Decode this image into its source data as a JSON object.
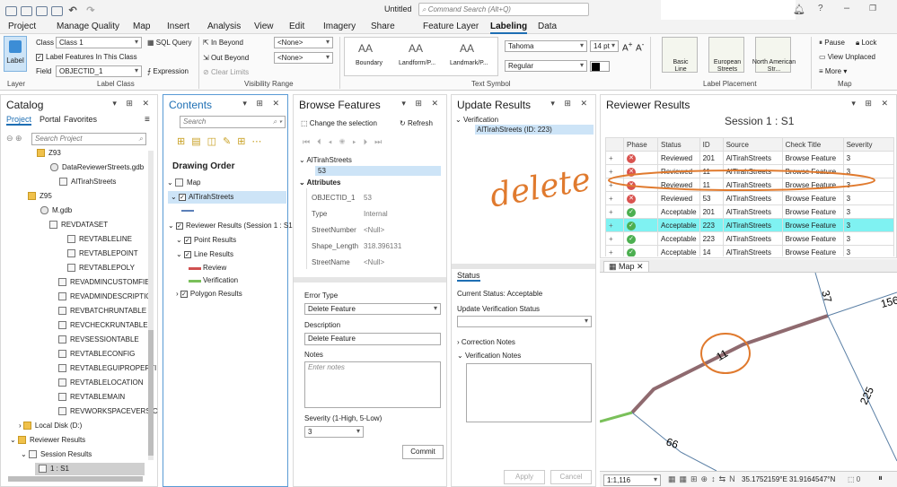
{
  "app": {
    "title": "Untitled",
    "command_search": "Command Search (Alt+Q)"
  },
  "tabs": [
    "Project",
    "Manage Quality",
    "Map",
    "Insert",
    "Analysis",
    "View",
    "Edit",
    "Imagery",
    "Share",
    "Feature Layer",
    "Labeling",
    "Data"
  ],
  "ribbon": {
    "label_button": "Label",
    "class_label": "Class",
    "class_value": "Class 1",
    "sql_query": "SQL Query",
    "label_features": "Label Features In This Class",
    "field_label": "Field",
    "field_value": "OBJECTID_1",
    "expression": "Expression",
    "label_class_group": "Label Class",
    "in_beyond": "In Beyond",
    "out_beyond": "Out Beyond",
    "clear_limits": "Clear Limits",
    "none1": "<None>",
    "none2": "<None>",
    "visibility_group": "Visibility Range",
    "gallery": [
      "Boundary",
      "Landform/P...",
      "Landmark/P..."
    ],
    "font": "Tahoma",
    "size": "14 pt",
    "style": "Regular",
    "text_symbol_group": "Text Symbol",
    "placement": [
      "Basic Line",
      "European Streets",
      "North American Str..."
    ],
    "placement_group": "Label Placement",
    "pause": "Pause",
    "lock": "Lock",
    "view_unplaced": "View Unplaced",
    "more": "More",
    "map_group": "Map",
    "layer_group": "Layer"
  },
  "catalog": {
    "title": "Catalog",
    "tabs": [
      "Project",
      "Portal",
      "Favorites"
    ],
    "search": "Search Project",
    "items": [
      "Z93",
      "DataReviewerStreets.gdb",
      "AlTirahStreets",
      "Z95",
      "M.gdb",
      "REVDATASET",
      "REVTABLELINE",
      "REVTABLEPOINT",
      "REVTABLEPOLY",
      "REVADMINCUSTOMFIEI",
      "REVADMINDESCRIPTIO",
      "REVBATCHRUNTABLE",
      "REVCHECKRUNTABLE",
      "REVSESSIONTABLE",
      "REVTABLECONFIG",
      "REVTABLEGUIPROPERTI",
      "REVTABLELOCATION",
      "REVTABLEMAIN",
      "REVWORKSPACEVERSIC",
      "Local Disk (D:)",
      "Reviewer Results",
      "Session Results",
      "1 : S1"
    ]
  },
  "contents": {
    "title": "Contents",
    "search": "Search",
    "drawing_order": "Drawing Order",
    "map": "Map",
    "layer1": "AlTirahStreets",
    "reviewer": "Reviewer Results (Session 1 : S1",
    "point": "Point Results",
    "line": "Line Results",
    "review": "Review",
    "verified": "Verification",
    "polygon": "Polygon Results"
  },
  "browse": {
    "title": "Browse Features",
    "change_selection": "Change the selection",
    "refresh": "Refresh",
    "layer": "AlTirahStreets",
    "id": "53",
    "attributes": "Attributes",
    "attrs": [
      {
        "k": "OBJECTID_1",
        "v": "53"
      },
      {
        "k": "Type",
        "v": "Internal"
      },
      {
        "k": "StreetNumber",
        "v": "<Null>"
      },
      {
        "k": "Shape_Length",
        "v": "318.396131"
      },
      {
        "k": "StreetName",
        "v": "<Null>"
      }
    ],
    "error_type_label": "Error Type",
    "error_type": "Delete Feature",
    "description_label": "Description",
    "description": "Delete Feature",
    "notes_label": "Notes",
    "notes_placeholder": "Enter notes",
    "severity_label": "Severity (1-High, 5-Low)",
    "severity": "3",
    "commit": "Commit"
  },
  "update": {
    "title": "Update Results",
    "verification": "Verification",
    "item": "AlTirahStreets (ID: 223)",
    "handwriting": "delete",
    "status_tab": "Status",
    "current_status": "Current Status: Acceptable",
    "update_verification": "Update Verification Status",
    "correction_notes": "Correction Notes",
    "verification_notes": "Verification Notes",
    "apply": "Apply",
    "cancel": "Cancel"
  },
  "reviewer": {
    "title": "Reviewer Results",
    "session": "Session 1 : S1",
    "columns": [
      "Phase",
      "Status",
      "ID",
      "Source",
      "Check Title",
      "Severity"
    ],
    "rows": [
      {
        "phase": "x",
        "status": "Reviewed",
        "id": "201",
        "source": "AlTirahStreets",
        "check": "Browse Feature",
        "sev": "3"
      },
      {
        "phase": "x",
        "status": "Reviewed",
        "id": "11",
        "source": "AlTirahStreets",
        "check": "Browse Feature",
        "sev": "3"
      },
      {
        "phase": "x",
        "status": "Reviewed",
        "id": "11",
        "source": "AlTirahStreets",
        "check": "Browse Feature",
        "sev": "3"
      },
      {
        "phase": "x",
        "status": "Reviewed",
        "id": "53",
        "source": "AlTirahStreets",
        "check": "Browse Feature",
        "sev": "3"
      },
      {
        "phase": "ok",
        "status": "Acceptable",
        "id": "201",
        "source": "AlTirahStreets",
        "check": "Browse Feature",
        "sev": "3"
      },
      {
        "phase": "ok",
        "status": "Acceptable",
        "id": "223",
        "source": "AlTirahStreets",
        "check": "Browse Feature",
        "sev": "3"
      },
      {
        "phase": "ok",
        "status": "Acceptable",
        "id": "223",
        "source": "AlTirahStreets",
        "check": "Browse Feature",
        "sev": "3"
      },
      {
        "phase": "ok",
        "status": "Acceptable",
        "id": "14",
        "source": "AlTirahStreets",
        "check": "Browse Feature",
        "sev": "3"
      }
    ]
  },
  "map": {
    "tab": "Map",
    "labels": [
      "37",
      "156",
      "11",
      "225",
      "66"
    ],
    "scale": "1:1,116",
    "coords": "35.1752159°E 31.9164547°N",
    "selected": "0"
  }
}
